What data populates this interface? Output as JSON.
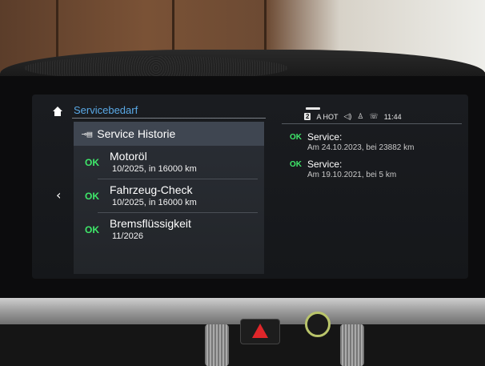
{
  "header": {
    "title": "Servicebedarf",
    "home_icon": "home-icon",
    "back_icon": "chevron-left-icon"
  },
  "status_bar": {
    "channel_badge": "2",
    "radio": "A HOT",
    "time": "11:44",
    "icons": [
      "sound-icon",
      "profile-icon",
      "connectivity-icon"
    ]
  },
  "menu": {
    "history_label": "Service Historie",
    "history_icon": "car-service-icon",
    "items": [
      {
        "status": "OK",
        "title": "Motoröl",
        "detail": "10/2025, in 16000 km"
      },
      {
        "status": "OK",
        "title": "Fahrzeug-Check",
        "detail": "10/2025, in 16000 km"
      },
      {
        "status": "OK",
        "title": "Bremsflüssigkeit",
        "detail": "11/2026"
      }
    ]
  },
  "history": [
    {
      "status": "OK",
      "title": "Service:",
      "detail": "Am 24.10.2023, bei 23882 km"
    },
    {
      "status": "OK",
      "title": "Service:",
      "detail": "Am 19.10.2021, bei 5 km"
    }
  ],
  "colors": {
    "accent_blue": "#5aa9e6",
    "ok_green": "#3fe86a",
    "hazard_red": "#e0262a"
  }
}
